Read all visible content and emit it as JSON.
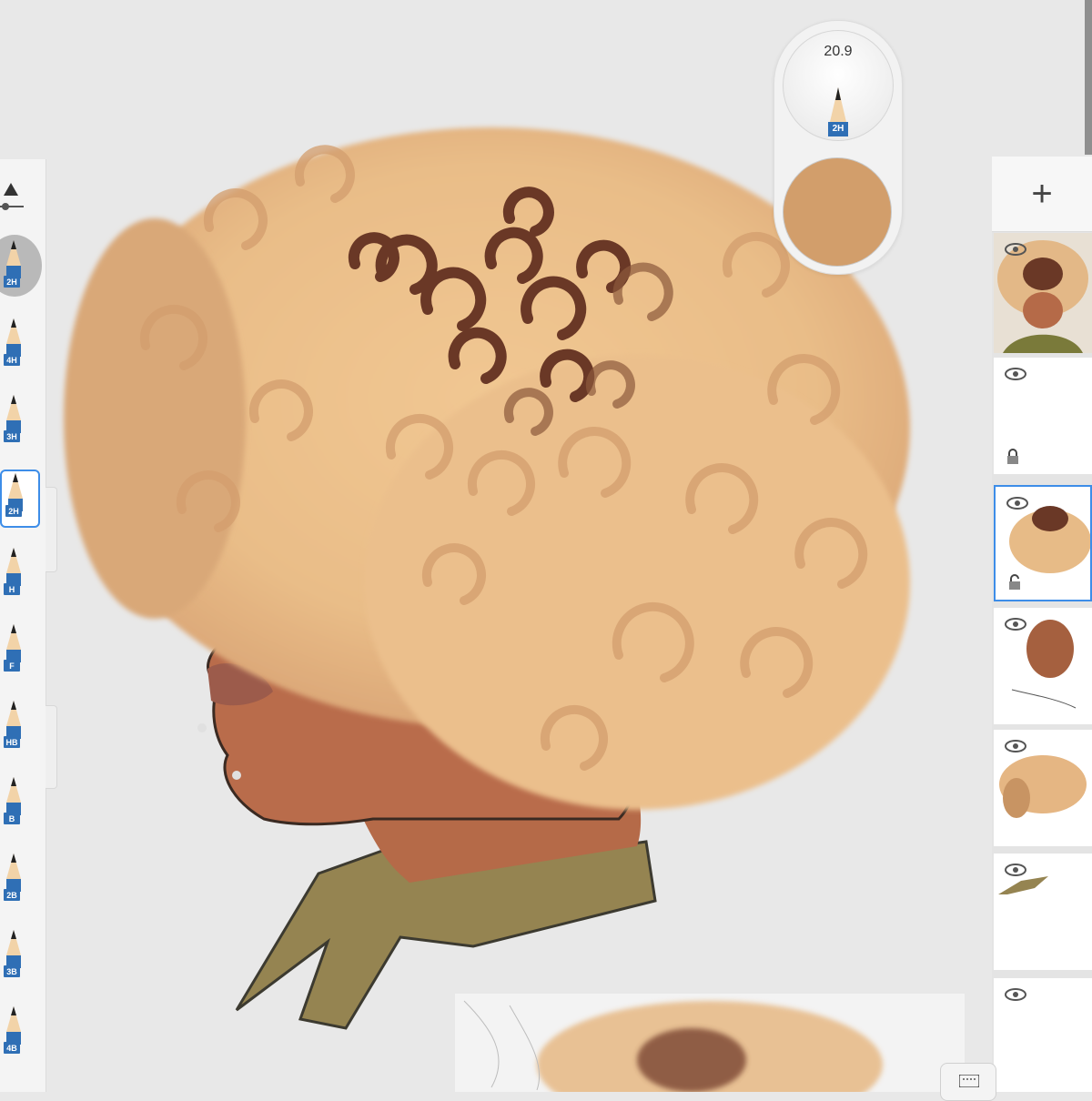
{
  "app": "sketch-drawing-app",
  "brush_puck": {
    "size_value": "20.9",
    "brush_label": "2H",
    "color": "#d29e6b"
  },
  "brush_library": {
    "current_label": "2H",
    "items": [
      {
        "label": "4H"
      },
      {
        "label": "3H"
      },
      {
        "label": "2H",
        "selected": true
      },
      {
        "label": "H"
      },
      {
        "label": "F"
      },
      {
        "label": "HB"
      },
      {
        "label": "B"
      },
      {
        "label": "2B"
      },
      {
        "label": "3B"
      },
      {
        "label": "4B"
      }
    ]
  },
  "layers_panel": {
    "add_symbol": "+",
    "layers": [
      {
        "name": "composite-thumbnail",
        "visible": true,
        "locked": false
      },
      {
        "name": "empty-layer",
        "visible": true,
        "locked": true
      },
      {
        "name": "hair-layer",
        "visible": true,
        "locked": false,
        "active": true
      },
      {
        "name": "face-layer",
        "visible": true,
        "locked": false
      },
      {
        "name": "hair-base-layer",
        "visible": true,
        "locked": false
      },
      {
        "name": "collar-layer",
        "visible": true,
        "locked": false
      },
      {
        "name": "bottom-layer",
        "visible": true,
        "locked": false
      }
    ]
  },
  "colors": {
    "skin": "#b76b4a",
    "hair_light": "#ebbf8c",
    "hair_dark": "#6a3826",
    "collar": "#958451",
    "accent_blue": "#3d8de8"
  }
}
